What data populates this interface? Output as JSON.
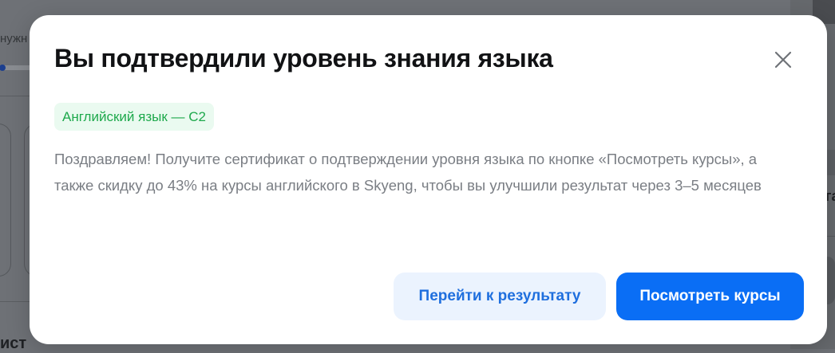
{
  "background": {
    "top_text": "нужн",
    "bottom_text": "ист",
    "right_text": "га"
  },
  "modal": {
    "title": "Вы подтвердили уровень знания языка",
    "close_icon": "close-icon",
    "badge": "Английский язык — С2",
    "description": "Поздравляем! Получите сертификат о подтверждении уровня языка по кнопке «Посмотреть курсы», а также скидку до 43% на курсы английского в Skyeng, чтобы вы улучшили результат через 3–5 месяцев",
    "buttons": {
      "secondary_label": "Перейти к результату",
      "primary_label": "Посмотреть курсы"
    }
  },
  "colors": {
    "overlay": "#6e7176",
    "modal_bg": "#ffffff",
    "badge_bg": "#eafaf0",
    "badge_text": "#1ea94c",
    "primary": "#0a6ef5",
    "secondary_bg": "#ebf3fe",
    "secondary_text": "#1f6fde",
    "body_text": "#7a7e84"
  }
}
